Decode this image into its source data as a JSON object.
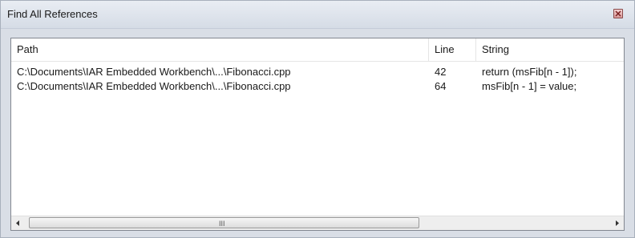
{
  "window": {
    "title": "Find All References"
  },
  "columns": [
    {
      "label": "Path"
    },
    {
      "label": "Line"
    },
    {
      "label": "String"
    }
  ],
  "rows": [
    {
      "path": "C:\\Documents\\IAR Embedded Workbench\\...\\Fibonacci.cpp",
      "line": "42",
      "string": "return (msFib[n - 1]);"
    },
    {
      "path": "C:\\Documents\\IAR Embedded Workbench\\...\\Fibonacci.cpp",
      "line": "64",
      "string": "msFib[n - 1] = value;"
    }
  ],
  "scrollbar": {
    "grip": "III"
  },
  "icons": {
    "close": "close-icon",
    "left": "arrow-left-icon",
    "right": "arrow-right-icon"
  },
  "colors": {
    "titlebar": "#dde3eb",
    "close_button": "#d99a9a",
    "background": "#d9dee6"
  }
}
